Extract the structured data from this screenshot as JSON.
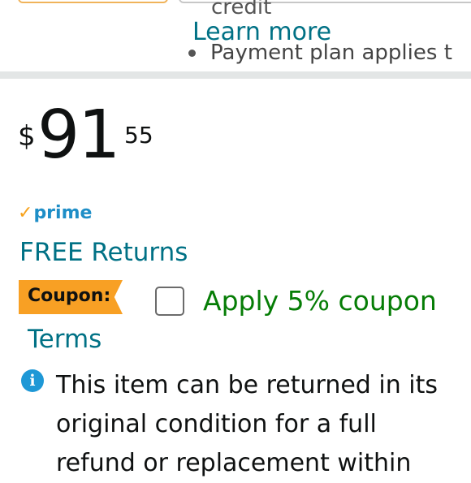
{
  "header_fragment": {
    "credit": "credit",
    "learn_more": "Learn more",
    "payment_plan": "Payment plan applies t"
  },
  "price": {
    "symbol": "$",
    "whole": "91",
    "fraction": "55"
  },
  "prime": {
    "check": "✓",
    "label": "prime"
  },
  "free_returns": "FREE Returns",
  "coupon": {
    "badge": "Coupon:",
    "apply": "Apply 5% coupon",
    "checked": false
  },
  "terms": "Terms",
  "return_info": {
    "icon": "info-icon",
    "text": "This item can be returned in its original condition for a full refund or replacement within"
  },
  "colors": {
    "link": "#007185",
    "coupon_badge": "#f8a024",
    "coupon_apply": "#067d06",
    "prime_check": "#f7a21b",
    "info_icon": "#1e98d6"
  }
}
